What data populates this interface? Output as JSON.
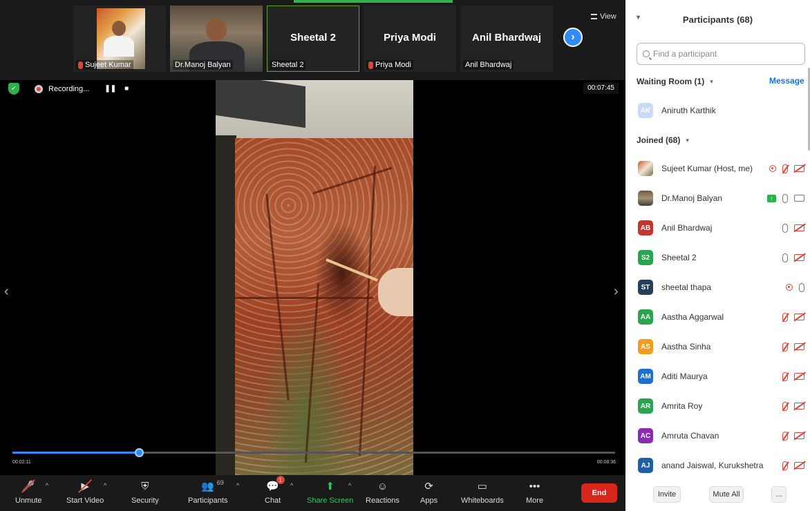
{
  "thumbs": [
    {
      "name": "Sujeet Kumar",
      "muted": true,
      "video": true
    },
    {
      "name": "Dr.Manoj Balyan",
      "muted": false,
      "video": true
    },
    {
      "name": "Sheetal 2",
      "big": "Sheetal 2",
      "muted": false,
      "video": false
    },
    {
      "name": "Priya Modi",
      "big": "Priya Modi",
      "muted": true,
      "video": false
    },
    {
      "name": "Anil Bhardwaj",
      "big": "Anil Bhardwaj",
      "muted": false,
      "video": false
    }
  ],
  "view_label": "View",
  "recording": {
    "label": "Recording...",
    "timer": "00:07:45"
  },
  "playback": {
    "current": "00:02:11",
    "total": "00:08:36",
    "progress_fraction": 0.21
  },
  "toolbar": {
    "unmute": "Unmute",
    "start_video": "Start Video",
    "security": "Security",
    "participants": "Participants",
    "participants_count": "69",
    "chat": "Chat",
    "chat_badge": "1",
    "share_screen": "Share Screen",
    "reactions": "Reactions",
    "apps": "Apps",
    "whiteboards": "Whiteboards",
    "more": "More",
    "end": "End"
  },
  "panel": {
    "title": "Participants (68)",
    "search_placeholder": "Find a participant",
    "waiting_room": "Waiting Room (1)",
    "message": "Message",
    "waiting": [
      {
        "initials": "AK",
        "name": "Aniruth Karthik",
        "color": "#c9daf8"
      }
    ],
    "joined": "Joined (68)",
    "participants": [
      {
        "initials": "",
        "name": "Sujeet Kumar (Host, me)",
        "avatar": "photo1",
        "icons": [
          "rec",
          "mic-off",
          "vid-off"
        ]
      },
      {
        "initials": "",
        "name": "Dr.Manoj Balyan",
        "avatar": "photo2",
        "icons": [
          "share",
          "mic",
          "vid"
        ]
      },
      {
        "initials": "AB",
        "name": "Anil Bhardwaj",
        "color": "#c5352b",
        "icons": [
          "mic",
          "vid-off"
        ]
      },
      {
        "initials": "S2",
        "name": "Sheetal 2",
        "color": "#2aa44f",
        "icons": [
          "mic",
          "vid-off"
        ]
      },
      {
        "initials": "ST",
        "name": "sheetal thapa",
        "color": "#263f5b",
        "icons": [
          "rec",
          "mic"
        ]
      },
      {
        "initials": "AA",
        "name": "Aastha Aggarwal",
        "color": "#2aa44f",
        "icons": [
          "mic-off",
          "vid-off"
        ]
      },
      {
        "initials": "AS",
        "name": "Aastha Sinha",
        "color": "#f29c1f",
        "icons": [
          "mic-off",
          "vid-off"
        ]
      },
      {
        "initials": "AM",
        "name": "Aditi Maurya",
        "color": "#1f6fd1",
        "icons": [
          "mic-off",
          "vid-off"
        ]
      },
      {
        "initials": "AR",
        "name": "Amrita Roy",
        "color": "#2aa44f",
        "icons": [
          "mic-off",
          "vid-off"
        ]
      },
      {
        "initials": "AC",
        "name": "Amruta Chavan",
        "color": "#8a2bb3",
        "icons": [
          "mic-off",
          "vid-off"
        ]
      },
      {
        "initials": "AJ",
        "name": "anand Jaiswal, Kurukshetra",
        "color": "#1f5fa8",
        "icons": [
          "mic-off",
          "vid-off"
        ]
      }
    ],
    "invite": "Invite",
    "mute_all": "Mute All",
    "more": "..."
  }
}
